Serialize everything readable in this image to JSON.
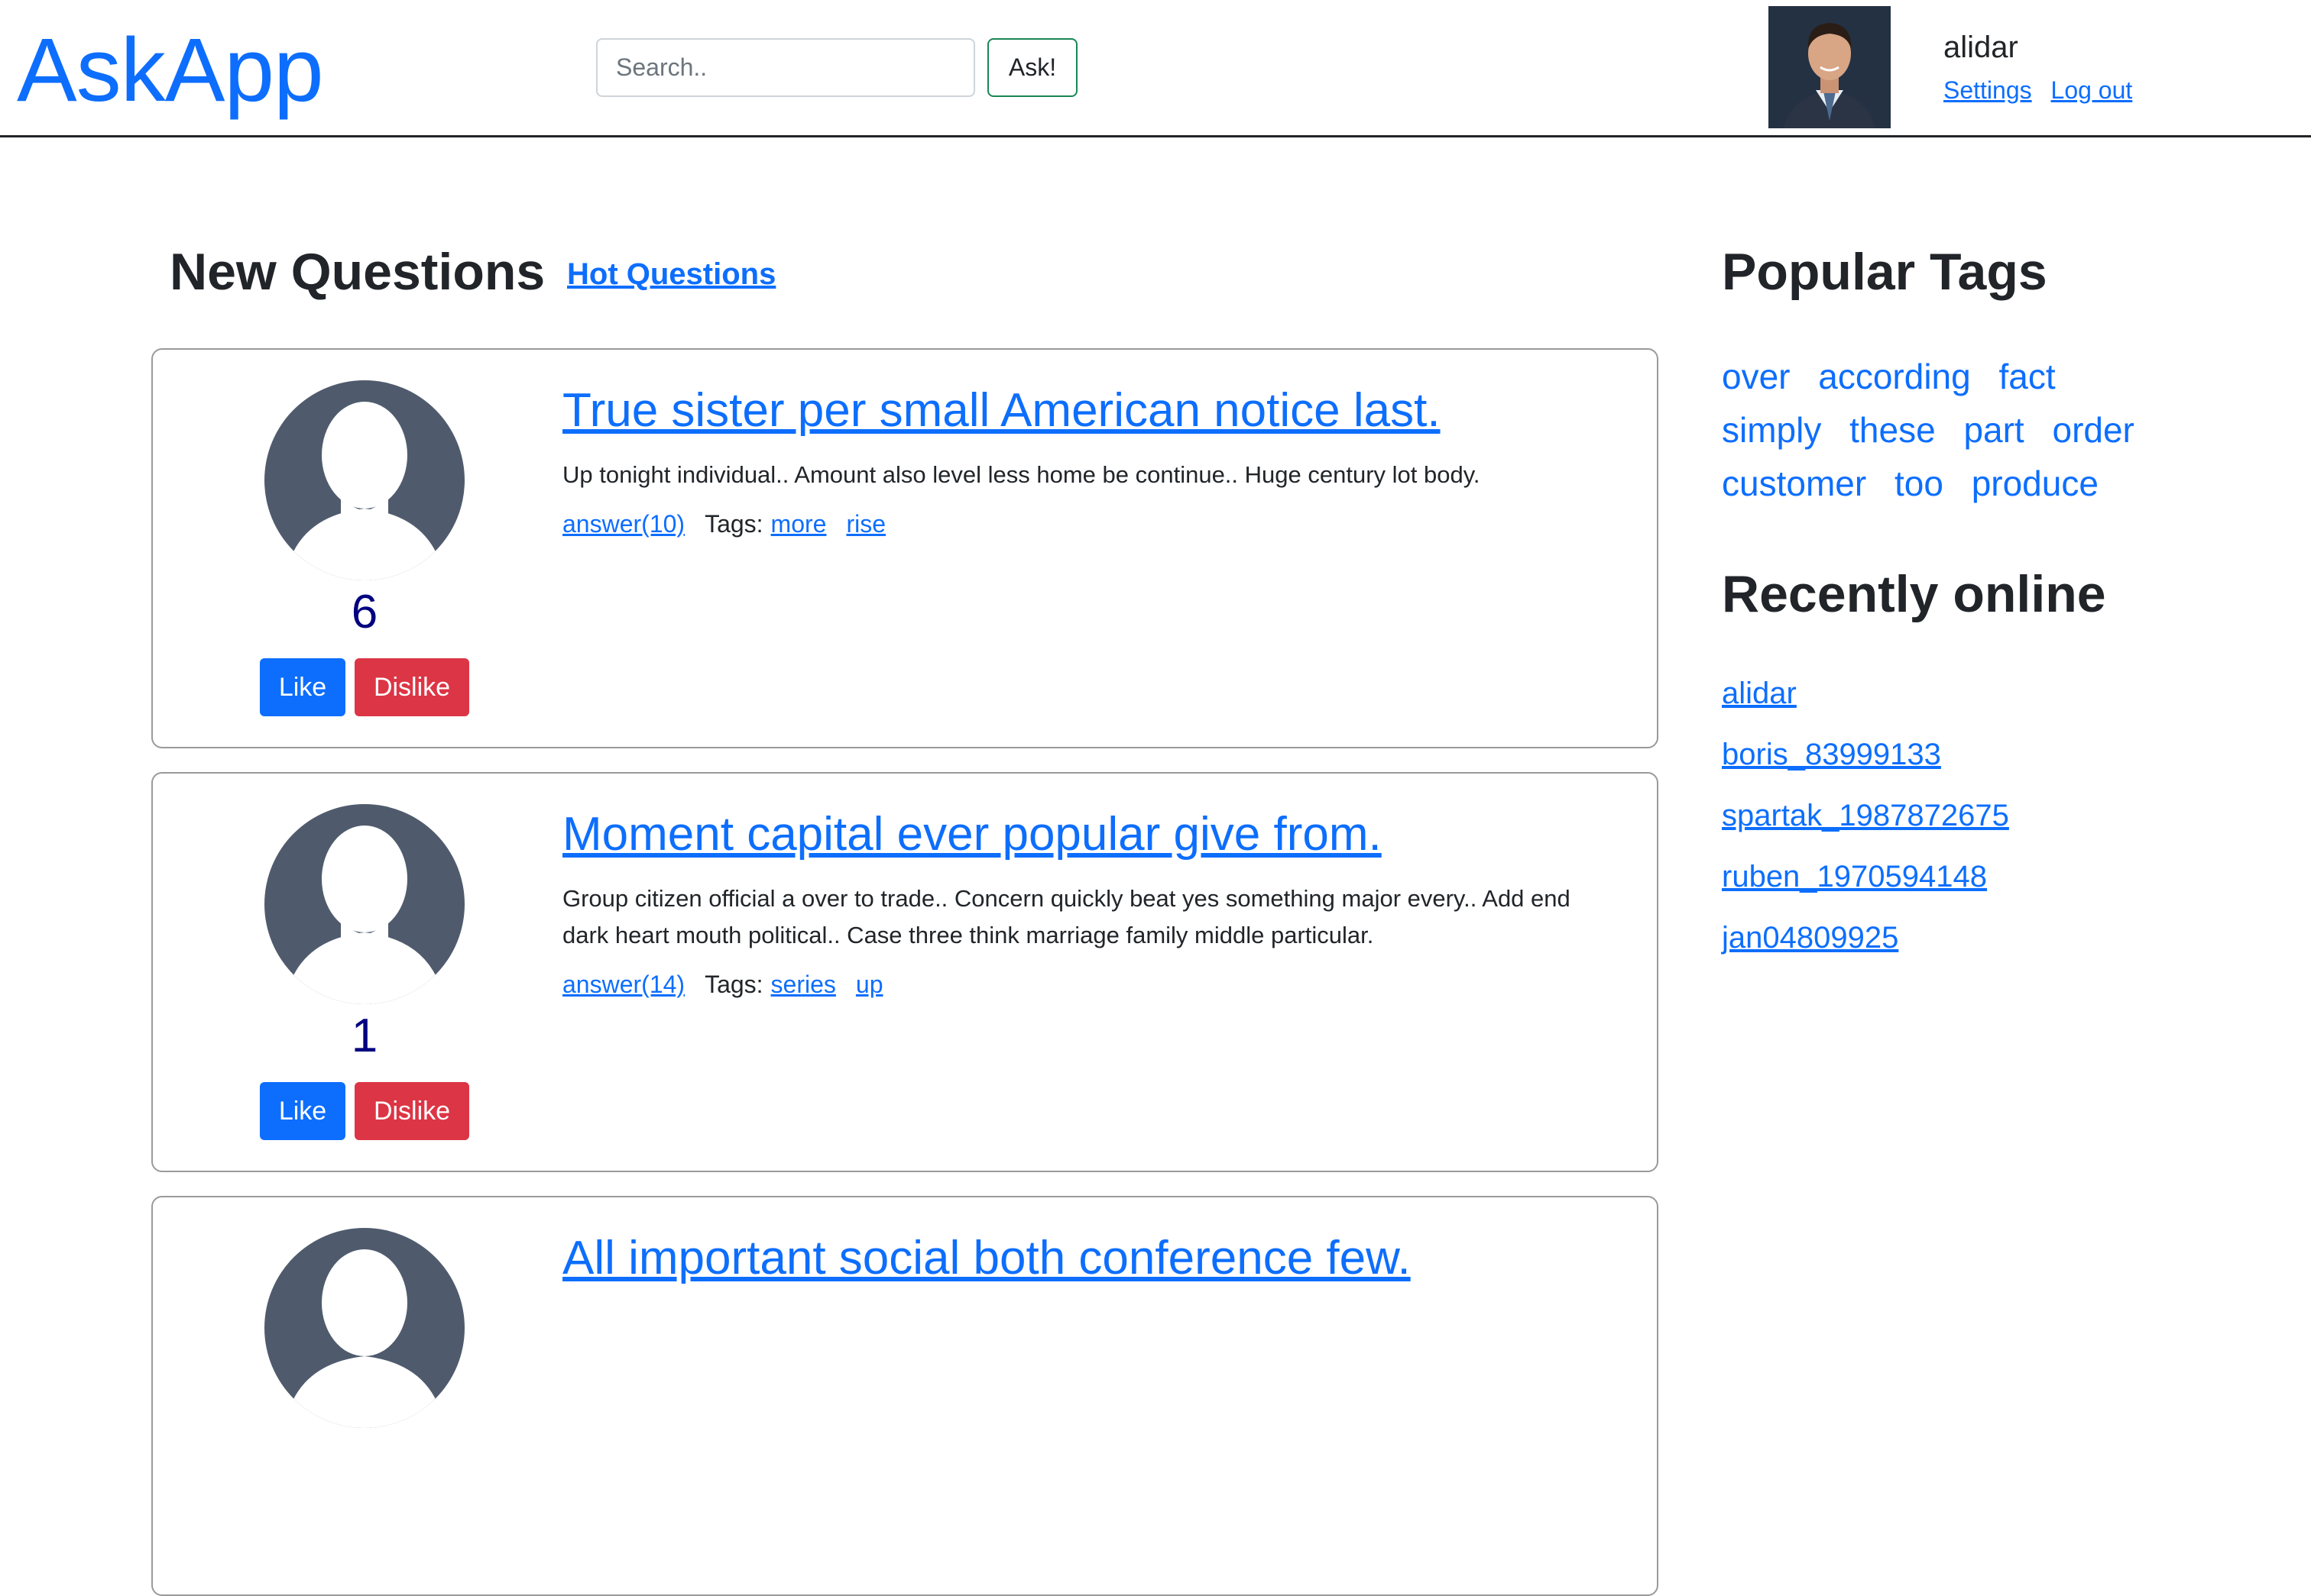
{
  "header": {
    "logo": "AskApp",
    "search_placeholder": "Search..",
    "ask_label": "Ask!",
    "username": "alidar",
    "settings_label": "Settings",
    "logout_label": "Log out"
  },
  "main": {
    "title": "New Questions",
    "hot_link": "Hot Questions",
    "questions": [
      {
        "title": "True sister per small American notice last.",
        "body": "Up tonight individual.. Amount also level less home be continue.. Huge century lot body.",
        "answers": "answer(10)",
        "tags_label": "Tags:",
        "tags": [
          "more",
          "rise"
        ],
        "rating": "6",
        "like": "Like",
        "dislike": "Dislike"
      },
      {
        "title": "Moment capital ever popular give from.",
        "body": "Group citizen official a over to trade.. Concern quickly beat yes something major every.. Add end dark heart mouth political.. Case three think marriage family middle particular.",
        "answers": "answer(14)",
        "tags_label": "Tags:",
        "tags": [
          "series",
          "up"
        ],
        "rating": "1",
        "like": "Like",
        "dislike": "Dislike"
      },
      {
        "title": "All important social both conference few."
      }
    ]
  },
  "sidebar": {
    "popular_tags_title": "Popular Tags",
    "tags": [
      "over",
      "according",
      "fact",
      "simply",
      "these",
      "part",
      "order",
      "customer",
      "too",
      "produce"
    ],
    "recently_online_title": "Recently online",
    "users": [
      "alidar",
      "boris_83999133",
      "spartak_1987872675",
      "ruben_1970594148",
      "jan04809925"
    ]
  },
  "colors": {
    "link": "#0d6efd",
    "like": "#0d6efd",
    "dislike": "#dc3545",
    "rating": "#000080",
    "avatar_gray": "#4f5b6d"
  }
}
